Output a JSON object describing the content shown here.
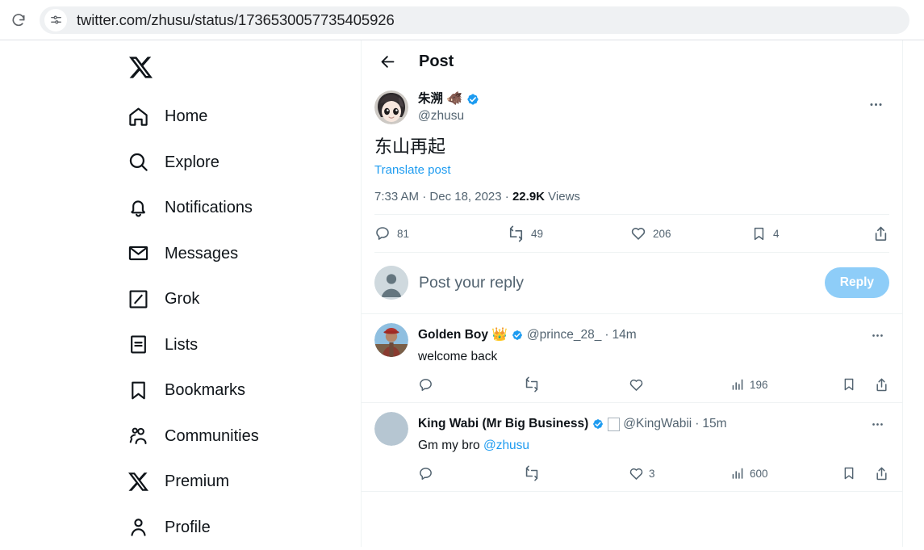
{
  "browser": {
    "reload_icon": "reload-icon",
    "site_info_icon": "site-settings-icon",
    "url": "twitter.com/zhusu/status/1736530057735405926"
  },
  "colors": {
    "accent": "#1d9bf0",
    "text_primary": "#0f1419",
    "text_secondary": "#536471",
    "border": "#eff3f4",
    "reply_button": "#8ecdf8"
  },
  "sidebar": {
    "logo": "x-logo-icon",
    "items": [
      {
        "label": "Home",
        "icon": "home-icon"
      },
      {
        "label": "Explore",
        "icon": "search-icon"
      },
      {
        "label": "Notifications",
        "icon": "bell-icon"
      },
      {
        "label": "Messages",
        "icon": "envelope-icon"
      },
      {
        "label": "Grok",
        "icon": "grok-icon"
      },
      {
        "label": "Lists",
        "icon": "lists-icon"
      },
      {
        "label": "Bookmarks",
        "icon": "bookmark-icon"
      },
      {
        "label": "Communities",
        "icon": "communities-icon"
      },
      {
        "label": "Premium",
        "icon": "x-premium-icon"
      },
      {
        "label": "Profile",
        "icon": "person-icon"
      }
    ]
  },
  "header": {
    "back_icon": "back-arrow-icon",
    "title": "Post"
  },
  "post": {
    "author": {
      "display_name": "朱溯",
      "name_emoji": "🐗",
      "verified": true,
      "handle": "@zhusu",
      "avatar": "anime-girl-avatar"
    },
    "more_icon": "more-options-icon",
    "text": "东山再起",
    "translate_link": "Translate post",
    "time": "7:33 AM",
    "date": "Dec 18, 2023",
    "views_count": "22.9K",
    "views_label": "Views",
    "separator": "·",
    "actions": {
      "reply": {
        "count": "81",
        "icon": "reply-icon"
      },
      "repost": {
        "count": "49",
        "icon": "repost-icon"
      },
      "like": {
        "count": "206",
        "icon": "like-icon"
      },
      "bookmark": {
        "count": "4",
        "icon": "bookmark-icon"
      },
      "share": {
        "count": "",
        "icon": "share-icon"
      }
    }
  },
  "composer": {
    "avatar": "default-avatar",
    "placeholder": "Post your reply",
    "value": "",
    "submit_label": "Reply"
  },
  "replies": [
    {
      "display_name": "Golden Boy",
      "name_emoji": "👑",
      "verified": true,
      "has_tofu_box": false,
      "handle": "@prince_28_",
      "separator": "·",
      "time": "14m",
      "text_before_mention": "welcome back",
      "mention": "",
      "avatar": "red-cap-person-avatar",
      "more_icon": "more-options-icon",
      "actions": {
        "reply": {
          "count": "",
          "icon": "reply-icon"
        },
        "repost": {
          "count": "",
          "icon": "repost-icon"
        },
        "like": {
          "count": "",
          "icon": "like-icon"
        },
        "views": {
          "count": "196",
          "icon": "views-icon"
        },
        "bookmark": {
          "count": "",
          "icon": "bookmark-icon"
        },
        "share": {
          "count": "",
          "icon": "share-icon"
        }
      }
    },
    {
      "display_name": "King Wabi (Mr Big Business)",
      "name_emoji": "",
      "verified": true,
      "has_tofu_box": true,
      "handle": "@KingWabii",
      "separator": "·",
      "time": "15m",
      "text_before_mention": "Gm my bro ",
      "mention": "@zhusu",
      "avatar": "blank-gray-avatar",
      "more_icon": "more-options-icon",
      "actions": {
        "reply": {
          "count": "",
          "icon": "reply-icon"
        },
        "repost": {
          "count": "",
          "icon": "repost-icon"
        },
        "like": {
          "count": "3",
          "icon": "like-icon"
        },
        "views": {
          "count": "600",
          "icon": "views-icon"
        },
        "bookmark": {
          "count": "",
          "icon": "bookmark-icon"
        },
        "share": {
          "count": "",
          "icon": "share-icon"
        }
      }
    }
  ]
}
